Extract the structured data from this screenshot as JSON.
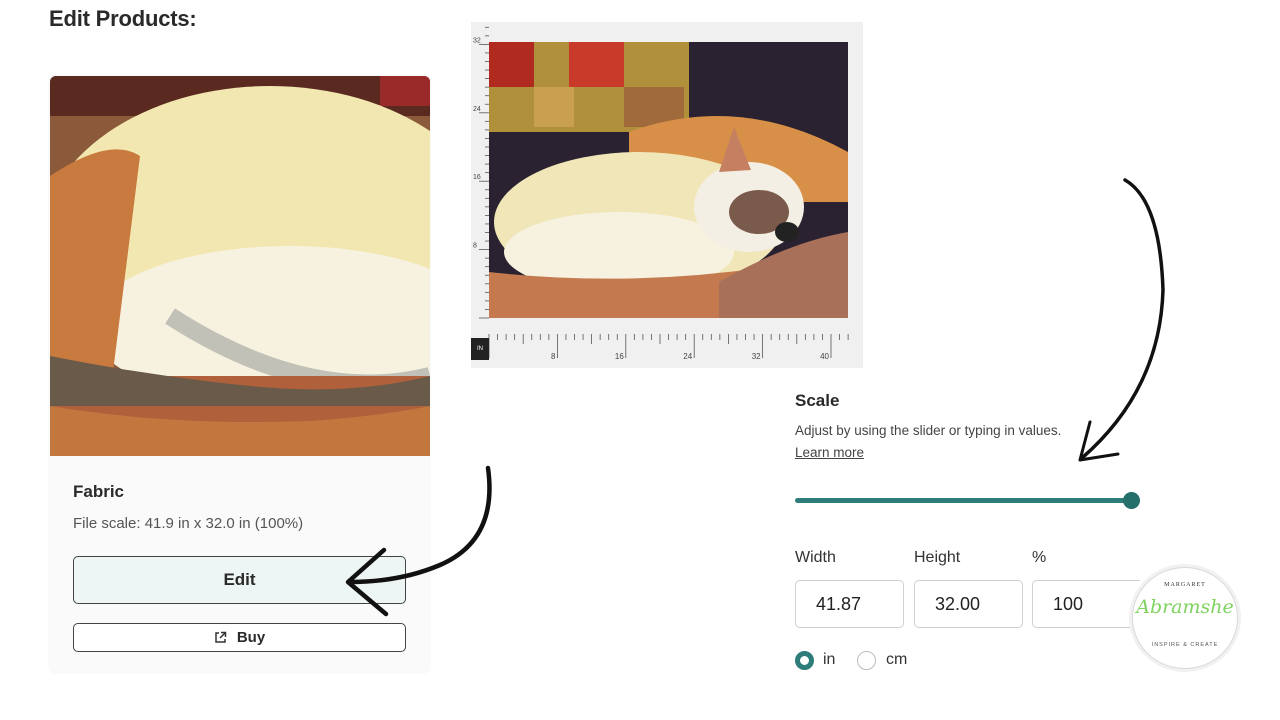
{
  "page": {
    "heading": "Edit Products:"
  },
  "product_card": {
    "title": "Fabric",
    "file_scale": "File scale: 41.9 in x 32.0 in (100%)",
    "edit_label": "Edit",
    "buy_label": "Buy",
    "buy_icon": "external-link-icon"
  },
  "preview": {
    "ruler_unit": "IN",
    "bottom_ticks": [
      "8",
      "16",
      "24",
      "32",
      "40"
    ],
    "left_ticks": [
      "32",
      "24",
      "16",
      "8"
    ]
  },
  "scale": {
    "title": "Scale",
    "help_text": "Adjust by using the slider or typing in values.",
    "learn_more": "Learn more",
    "slider_value_fraction": 1.0,
    "width_label": "Width",
    "height_label": "Height",
    "percent_label": "%",
    "width_value": "41.87",
    "height_value": "32.00",
    "percent_value": "100",
    "unit_in": "in",
    "unit_cm": "cm",
    "selected_unit": "in"
  },
  "logo": {
    "top_text": "MARGARET",
    "script_text": "Abramshe",
    "bottom_text": "INSPIRE & CREATE"
  },
  "colors": {
    "accent": "#2e7d7b",
    "edit_button_bg": "#eef6f5",
    "logo_green": "#7fd35e"
  }
}
